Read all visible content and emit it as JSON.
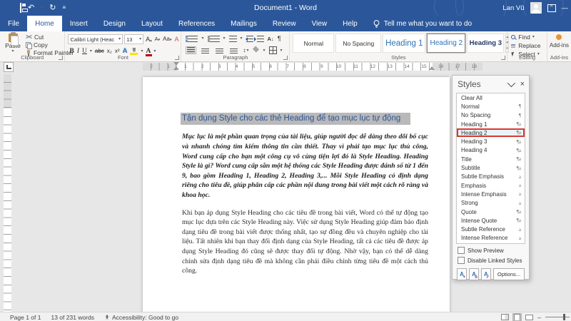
{
  "colors": {
    "titlebar_blue": "#2b579a",
    "heading_blue": "#2f5496",
    "selection_grey": "#b9b9b9",
    "pane_highlight_red": "#d63a2f",
    "gallery_heading_blue": "#2e74b5",
    "addin_orange": "#e8943a"
  },
  "titlebar": {
    "title": "Document1 - Word",
    "user_name": "Lan Vũ"
  },
  "glyphs": {
    "undo": "↶",
    "redo": "↻",
    "minimize": "—",
    "maximize": "^",
    "close_pane": "×",
    "dropdown": "▾",
    "up": "▴",
    "more": "≡",
    "pilcrow": "¶",
    "sort": "A↓",
    "line_spacing": "↕",
    "minus": "–"
  },
  "tabs": {
    "items": [
      {
        "label": "File"
      },
      {
        "label": "Home",
        "selected": true
      },
      {
        "label": "Insert"
      },
      {
        "label": "Design"
      },
      {
        "label": "Layout"
      },
      {
        "label": "References"
      },
      {
        "label": "Mailings"
      },
      {
        "label": "Review"
      },
      {
        "label": "View"
      },
      {
        "label": "Help"
      }
    ],
    "tell_me": "Tell me what you want to do"
  },
  "ribbon": {
    "clipboard": {
      "label": "Clipboard",
      "paste": "Paste",
      "cut": "Cut",
      "copy": "Copy",
      "format_painter": "Format Painter"
    },
    "font": {
      "label": "Font",
      "name": "Calibri Light (Heac",
      "size": "13",
      "grow": "A",
      "shrink": "A",
      "case": "Aa",
      "clear": "A",
      "bold": "B",
      "italic": "I",
      "underline": "U",
      "strike": "abc",
      "subscript": "x₂",
      "superscript": "x²",
      "effects": "A",
      "font_color": "A"
    },
    "paragraph": {
      "label": "Paragraph"
    },
    "styles": {
      "label": "Styles",
      "gallery": [
        {
          "label": "Normal"
        },
        {
          "label": "No Spacing"
        },
        {
          "label": "Heading 1"
        },
        {
          "label": "Heading 2",
          "selected": true
        },
        {
          "label": "Heading 3"
        }
      ]
    },
    "editing": {
      "label": "Editing",
      "find": "Find",
      "replace": "Replace",
      "select": "Select"
    },
    "addins": {
      "label": "Add-ins",
      "button": "Add-ins"
    }
  },
  "ruler": {
    "left_numbers": [
      "2",
      "1"
    ],
    "main_numbers": [
      "1",
      "2",
      "3",
      "4",
      "5",
      "6",
      "7",
      "8",
      "9",
      "10",
      "11",
      "12",
      "13",
      "14",
      "15"
    ],
    "right_numbers": [
      "16",
      "17",
      "18"
    ]
  },
  "document": {
    "heading": "Tận dụng Style cho các thẻ Heading để tạo mục lục tự động",
    "para1": "Mục lục là một phần quan trọng của tài liệu, giúp người đọc dễ dàng theo dõi bố cục và nhanh chóng tìm kiếm thông tin cần thiết. Thay vì phải tạo mục lục thủ công, Word cung cấp cho bạn một công cụ vô cùng tiện lợi đó là Style Heading. Heading Style là gì? Word cung cấp sẵn một hệ thống các Style Heading được đánh số từ 1 đến 9, bao gồm Heading 1, Heading 2, Heading 3,... Mỗi Style Heading có định dạng riêng cho tiêu đề, giúp phân cấp các phần nội dung trong bài viết một cách rõ ràng và khoa học.",
    "para2": "Khi bạn áp dụng Style Heading cho các tiêu đề trong bài viết, Word có thể tự động tạo mục lục dựa trên các Style Heading này. Việc sử dụng Style Heading giúp đảm bảo định dạng tiêu đề trong bài viết được thống nhất, tạo sự đồng đều và chuyên nghiệp cho tài liệu. Tất nhiên khi bạn thay đổi định dạng của Style Heading, tất cả các tiêu đề được áp dụng Style Heading đó cũng sẽ được thay đổi tự động. Nhờ vậy, bạn có thể dễ dàng chỉnh sửa định dạng tiêu đề mà không cần phải điều chỉnh từng tiêu đề một cách thủ công."
  },
  "styles_pane": {
    "title": "Styles",
    "items": [
      {
        "label": "Clear All",
        "symbol": ""
      },
      {
        "label": "Normal",
        "symbol": "¶"
      },
      {
        "label": "No Spacing",
        "symbol": "¶"
      },
      {
        "label": "Heading 1",
        "symbol": "¶a"
      },
      {
        "label": "Heading 2",
        "symbol": "¶a",
        "highlighted": true
      },
      {
        "label": "Heading 3",
        "symbol": "¶a"
      },
      {
        "label": "Heading 4",
        "symbol": "¶a"
      },
      {
        "label": "Title",
        "symbol": "¶a"
      },
      {
        "label": "Subtitle",
        "symbol": "¶a"
      },
      {
        "label": "Subtle Emphasis",
        "symbol": "a"
      },
      {
        "label": "Emphasis",
        "symbol": "a"
      },
      {
        "label": "Intense Emphasis",
        "symbol": "a"
      },
      {
        "label": "Strong",
        "symbol": "a"
      },
      {
        "label": "Quote",
        "symbol": "¶a"
      },
      {
        "label": "Intense Quote",
        "symbol": "¶a"
      },
      {
        "label": "Subtle Reference",
        "symbol": "a"
      },
      {
        "label": "Intense Reference",
        "symbol": "a"
      }
    ],
    "show_preview": "Show Preview",
    "disable_linked": "Disable Linked Styles",
    "options": "Options..."
  },
  "statusbar": {
    "page": "Page 1 of 1",
    "words": "13 of 231 words",
    "accessibility": "Accessibility: Good to go"
  }
}
